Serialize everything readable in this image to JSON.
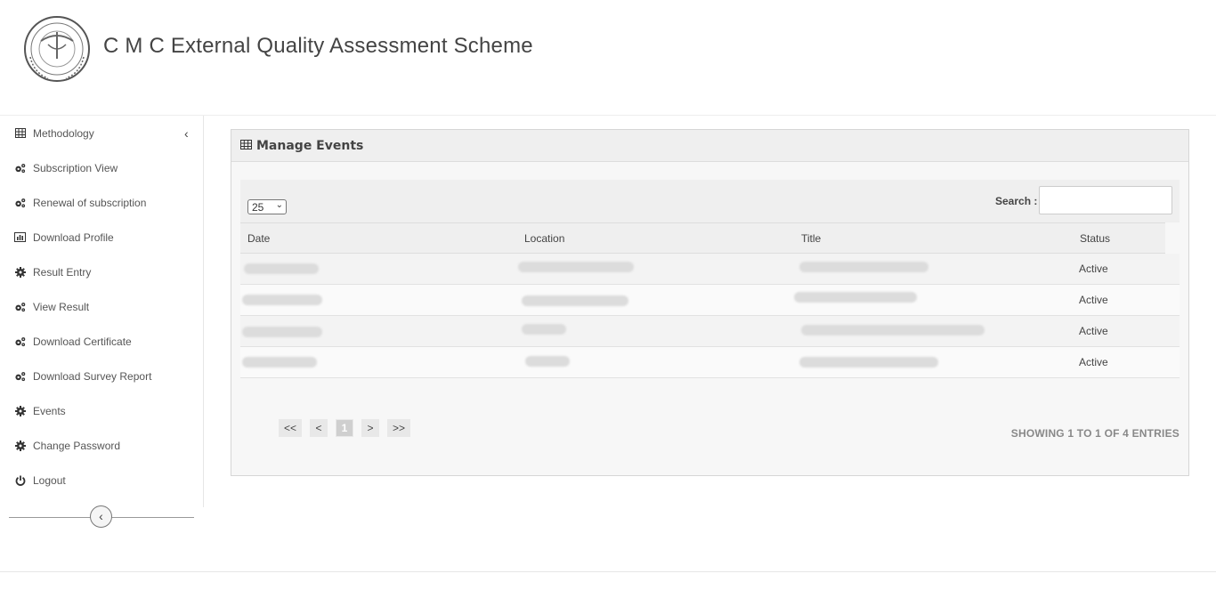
{
  "header": {
    "title": "C M C External Quality Assessment Scheme"
  },
  "sidebar": {
    "items": [
      {
        "label": "Methodology",
        "icon": "table-icon"
      },
      {
        "label": "Subscription View",
        "icon": "cogs-icon"
      },
      {
        "label": "Renewal of subscription",
        "icon": "cogs-icon"
      },
      {
        "label": "Download Profile",
        "icon": "bar-chart-icon"
      },
      {
        "label": "Result Entry",
        "icon": "gear-icon"
      },
      {
        "label": "View Result",
        "icon": "cogs-icon"
      },
      {
        "label": "Download Certificate",
        "icon": "cogs-icon"
      },
      {
        "label": "Download Survey Report",
        "icon": "cogs-icon"
      },
      {
        "label": "Events",
        "icon": "gear-icon"
      },
      {
        "label": "Change Password",
        "icon": "gear-icon"
      },
      {
        "label": "Logout",
        "icon": "power-icon"
      }
    ],
    "collapse_glyph": "‹",
    "toggle_glyph": "‹"
  },
  "panel": {
    "title": "Manage Events",
    "page_size": "25",
    "search_label": "Search :",
    "search_value": "",
    "columns": [
      "Date",
      "Location",
      "Title",
      "Status"
    ],
    "rows": [
      {
        "status": "Active"
      },
      {
        "status": "Active"
      },
      {
        "status": "Active"
      },
      {
        "status": "Active"
      }
    ],
    "pager": {
      "first": "<<",
      "prev": "<",
      "current": "1",
      "next": ">",
      "last": ">>"
    },
    "showing_text": "SHOWING 1 TO 1 OF 4 ENTRIES"
  }
}
